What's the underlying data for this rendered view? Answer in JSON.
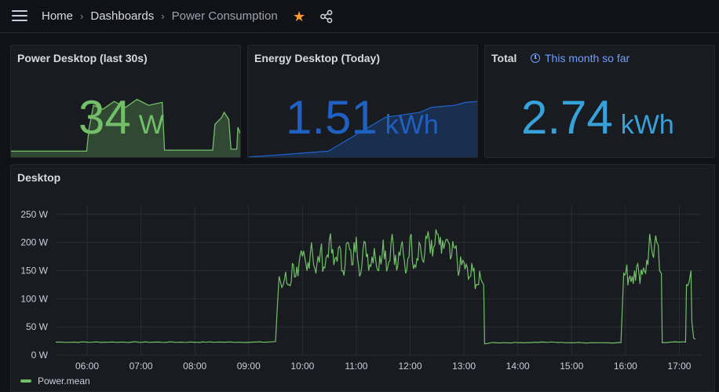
{
  "header": {
    "breadcrumb": [
      "Home",
      "Dashboards",
      "Power Consumption"
    ],
    "separator": "›"
  },
  "colors": {
    "green": "#73bf69",
    "blue": "#1f60c4",
    "lightblue": "#37a2da",
    "star": "#ff9830",
    "link": "#6e9fff"
  },
  "panels": {
    "power": {
      "title": "Power Desktop (last 30s)",
      "value": "34",
      "unit": "W"
    },
    "energy": {
      "title": "Energy Desktop (Today)",
      "value": "1.51",
      "unit": "kWh"
    },
    "total": {
      "title": "Total",
      "time_info": "This month so far",
      "value": "2.74",
      "unit": "kWh"
    },
    "desktop": {
      "title": "Desktop",
      "legend": "Power.mean"
    }
  },
  "chart_data": {
    "type": "line",
    "title": "Desktop",
    "x_ticks": [
      "06:00",
      "07:00",
      "08:00",
      "09:00",
      "10:00",
      "11:00",
      "12:00",
      "13:00",
      "14:00",
      "15:00",
      "16:00",
      "17:00"
    ],
    "y_ticks": [
      "0 W",
      "50 W",
      "100 W",
      "150 W",
      "200 W",
      "250 W"
    ],
    "ylim": [
      0,
      265
    ],
    "xlim": [
      "05:25",
      "17:25"
    ],
    "grid": true,
    "legend_placement": "bottom-left",
    "series": [
      {
        "name": "Power.mean",
        "color": "#73bf69",
        "points": [
          [
            "05:25",
            23
          ],
          [
            "06:30",
            23
          ],
          [
            "07:30",
            23
          ],
          [
            "08:30",
            23
          ],
          [
            "09:20",
            23
          ],
          [
            "09:30",
            24
          ],
          [
            "09:32",
            85
          ],
          [
            "09:34",
            140
          ],
          [
            "09:37",
            120
          ],
          [
            "09:40",
            135
          ],
          [
            "09:45",
            125
          ],
          [
            "09:50",
            160
          ],
          [
            "09:55",
            140
          ],
          [
            "10:00",
            175
          ],
          [
            "10:05",
            150
          ],
          [
            "10:10",
            200
          ],
          [
            "10:15",
            145
          ],
          [
            "10:20",
            185
          ],
          [
            "10:25",
            155
          ],
          [
            "10:30",
            205
          ],
          [
            "10:35",
            160
          ],
          [
            "10:40",
            190
          ],
          [
            "10:45",
            150
          ],
          [
            "10:50",
            200
          ],
          [
            "10:55",
            160
          ],
          [
            "11:00",
            210
          ],
          [
            "11:05",
            145
          ],
          [
            "11:10",
            200
          ],
          [
            "11:15",
            160
          ],
          [
            "11:20",
            190
          ],
          [
            "11:25",
            150
          ],
          [
            "11:30",
            205
          ],
          [
            "11:35",
            155
          ],
          [
            "11:40",
            215
          ],
          [
            "11:45",
            150
          ],
          [
            "11:50",
            195
          ],
          [
            "11:55",
            145
          ],
          [
            "12:00",
            210
          ],
          [
            "12:05",
            160
          ],
          [
            "12:10",
            200
          ],
          [
            "12:15",
            165
          ],
          [
            "12:20",
            220
          ],
          [
            "12:25",
            175
          ],
          [
            "12:30",
            215
          ],
          [
            "12:35",
            180
          ],
          [
            "12:40",
            205
          ],
          [
            "12:45",
            170
          ],
          [
            "12:50",
            190
          ],
          [
            "12:55",
            150
          ],
          [
            "13:00",
            165
          ],
          [
            "13:05",
            135
          ],
          [
            "13:10",
            150
          ],
          [
            "13:15",
            125
          ],
          [
            "13:20",
            130
          ],
          [
            "13:22",
            125
          ],
          [
            "13:23",
            20
          ],
          [
            "13:30",
            22
          ],
          [
            "14:00",
            22
          ],
          [
            "14:30",
            23
          ],
          [
            "15:00",
            22
          ],
          [
            "15:30",
            22
          ],
          [
            "15:55",
            22
          ],
          [
            "15:58",
            145
          ],
          [
            "16:05",
            140
          ],
          [
            "16:10",
            150
          ],
          [
            "16:15",
            145
          ],
          [
            "16:20",
            155
          ],
          [
            "16:25",
            160
          ],
          [
            "16:27",
            215
          ],
          [
            "16:30",
            180
          ],
          [
            "16:35",
            200
          ],
          [
            "16:38",
            150
          ],
          [
            "16:40",
            145
          ],
          [
            "16:41",
            22
          ],
          [
            "16:50",
            23
          ],
          [
            "17:00",
            23
          ],
          [
            "17:07",
            23
          ],
          [
            "17:08",
            125
          ],
          [
            "17:11",
            130
          ],
          [
            "17:13",
            150
          ],
          [
            "17:14",
            60
          ],
          [
            "17:16",
            30
          ],
          [
            "17:18",
            28
          ]
        ]
      }
    ]
  },
  "sparks": {
    "power": [
      [
        0,
        6
      ],
      [
        0.33,
        6
      ],
      [
        0.34,
        28
      ],
      [
        0.36,
        52
      ],
      [
        0.4,
        48
      ],
      [
        0.45,
        56
      ],
      [
        0.5,
        50
      ],
      [
        0.55,
        58
      ],
      [
        0.6,
        52
      ],
      [
        0.66,
        55
      ],
      [
        0.67,
        7
      ],
      [
        0.88,
        7
      ],
      [
        0.89,
        33
      ],
      [
        0.92,
        40
      ],
      [
        0.93,
        45
      ],
      [
        0.95,
        38
      ],
      [
        0.96,
        8
      ],
      [
        0.985,
        8
      ],
      [
        0.99,
        30
      ],
      [
        1,
        24
      ]
    ],
    "energy": [
      [
        0,
        0
      ],
      [
        0.35,
        6
      ],
      [
        0.6,
        40
      ],
      [
        0.75,
        45
      ],
      [
        0.8,
        50
      ],
      [
        0.9,
        52
      ],
      [
        0.95,
        55
      ],
      [
        1,
        56
      ]
    ]
  }
}
